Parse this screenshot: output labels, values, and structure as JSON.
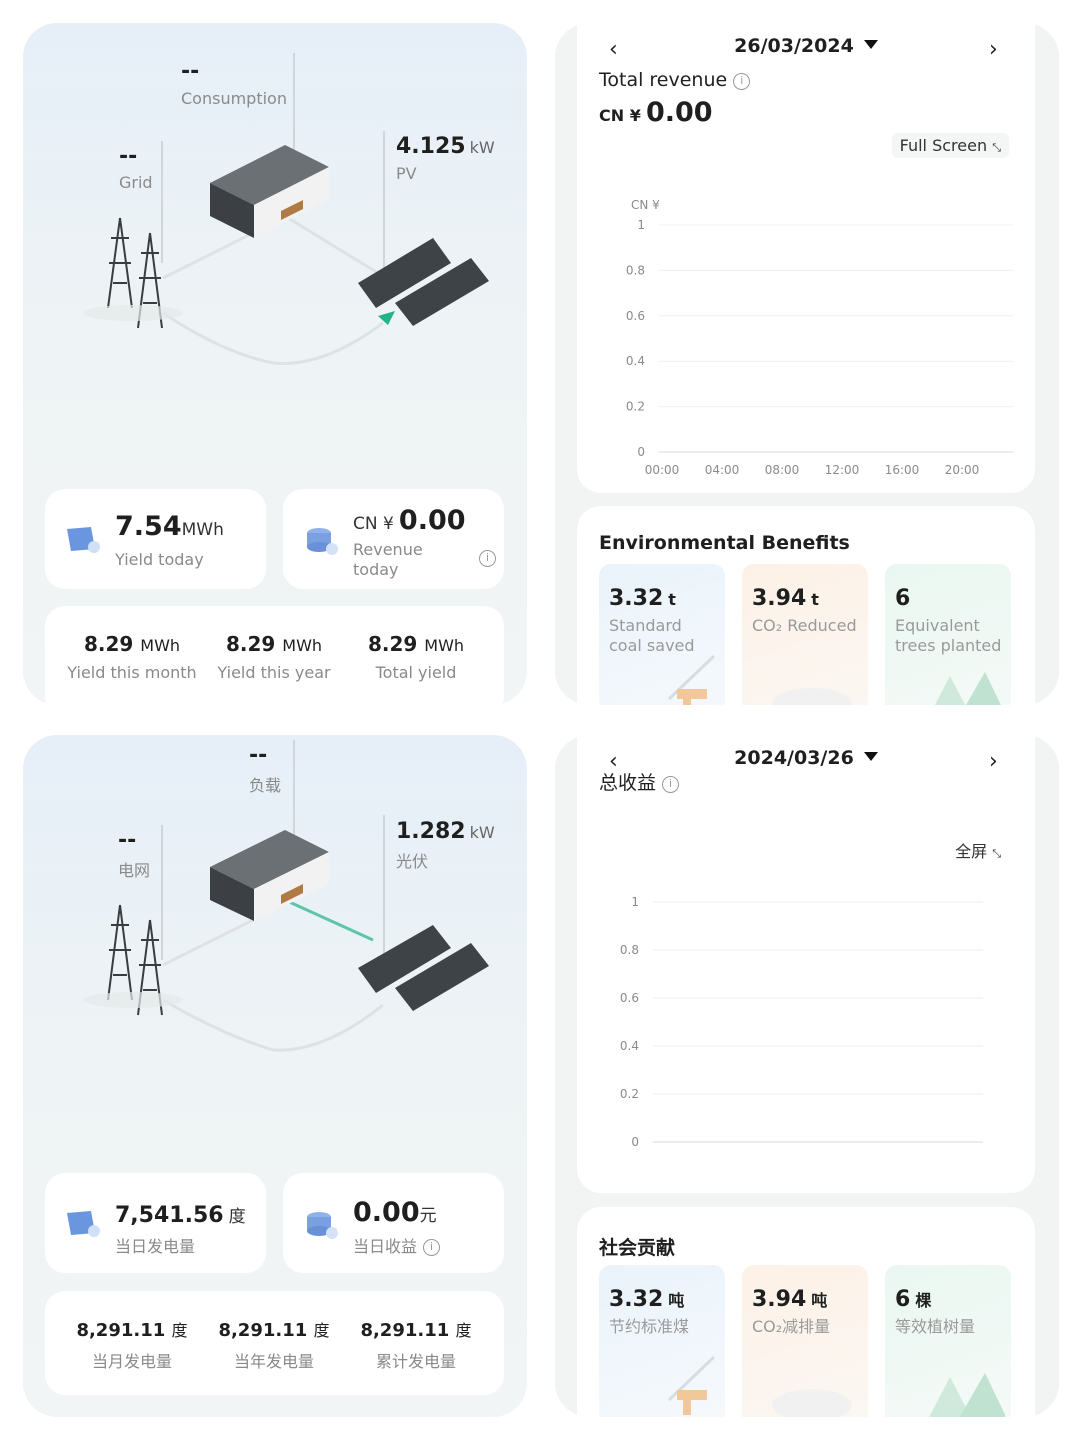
{
  "panel_en_energy": {
    "consumption": {
      "value": "--",
      "label": "Consumption"
    },
    "grid": {
      "value": "--",
      "label": "Grid"
    },
    "pv": {
      "value": "4.125",
      "unit": "kW",
      "label": "PV"
    },
    "yield_today": {
      "value": "7.54",
      "unit": "MWh",
      "label": "Yield today"
    },
    "revenue_today": {
      "currency": "CN ¥",
      "value": "0.00",
      "label_line1": "Revenue",
      "label_line2": "today"
    },
    "yields": [
      {
        "value": "8.29",
        "unit": "MWh",
        "label": "Yield this month"
      },
      {
        "value": "8.29",
        "unit": "MWh",
        "label": "Yield this year"
      },
      {
        "value": "8.29",
        "unit": "MWh",
        "label": "Total yield"
      }
    ]
  },
  "panel_en_revenue": {
    "prev_icon": "chevron-left",
    "next_icon": "chevron-right",
    "date": "26/03/2024",
    "title": "Total revenue",
    "currency": "CN ¥",
    "total": "0.00",
    "full_screen": "Full Screen",
    "env_title": "Environmental Benefits",
    "benefits": [
      {
        "value": "3.32",
        "unit": "t",
        "line1": "Standard",
        "line2": "coal saved"
      },
      {
        "value": "3.94",
        "unit": "t",
        "line1": "CO₂ Reduced",
        "line2": ""
      },
      {
        "value": "6",
        "unit": "",
        "line1": "Equivalent",
        "line2": "trees planted"
      }
    ]
  },
  "panel_zh_energy": {
    "consumption": {
      "value": "--",
      "label": "负载"
    },
    "grid": {
      "value": "--",
      "label": "电网"
    },
    "pv": {
      "value": "1.282",
      "unit": "kW",
      "label": "光伏"
    },
    "yield_today": {
      "value": "7,541.56",
      "unit": "度",
      "label": "当日发电量"
    },
    "revenue_today": {
      "value": "0.00",
      "unit": "元",
      "label": "当日收益"
    },
    "yields": [
      {
        "value": "8,291.11",
        "unit": "度",
        "label": "当月发电量"
      },
      {
        "value": "8,291.11",
        "unit": "度",
        "label": "当年发电量"
      },
      {
        "value": "8,291.11",
        "unit": "度",
        "label": "累计发电量"
      }
    ]
  },
  "panel_zh_revenue": {
    "date": "2024/03/26",
    "title": "总收益",
    "full_screen": "全屏",
    "env_title": "社会贡献",
    "benefits": [
      {
        "value": "3.32",
        "unit": "吨",
        "line1": "节约标准煤"
      },
      {
        "value": "3.94",
        "unit": "吨",
        "line1": "CO₂减排量"
      },
      {
        "value": "6",
        "unit": "棵",
        "line1": "等效植树量"
      }
    ]
  },
  "chart_data": [
    {
      "type": "line",
      "title": "",
      "ylabel": "CN ¥",
      "y_ticks": [
        "1",
        "0.8",
        "0.6",
        "0.4",
        "0.2",
        "0"
      ],
      "x_ticks": [
        "00:00",
        "04:00",
        "08:00",
        "12:00",
        "16:00",
        "20:00"
      ],
      "ylim": [
        0,
        1
      ],
      "series": [
        {
          "values": []
        }
      ],
      "grid": true
    },
    {
      "type": "line",
      "title": "",
      "ylabel": "",
      "y_ticks": [
        "1",
        "0.8",
        "0.6",
        "0.4",
        "0.2",
        "0"
      ],
      "x_ticks": [],
      "ylim": [
        0,
        1
      ],
      "series": [
        {
          "values": []
        }
      ],
      "grid": true
    }
  ]
}
